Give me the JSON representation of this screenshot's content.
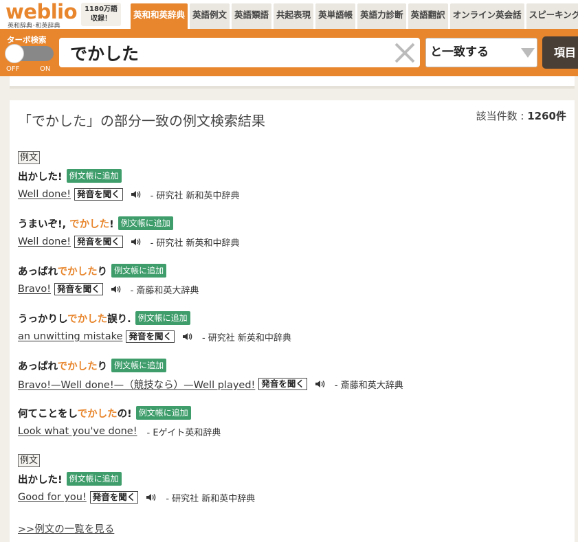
{
  "header": {
    "logo_text": "weblio",
    "logo_sub": "英和辞典･和英辞典",
    "count_line1": "1180万語",
    "count_line2": "収録！",
    "nav_tabs": [
      "英和和英辞典",
      "英語例文",
      "英語類語",
      "共起表現",
      "英単語帳",
      "英語力診断",
      "英語翻訳",
      "オンライン英会話",
      "スピーキング"
    ]
  },
  "search": {
    "turbo_label": "ターボ検索",
    "toggle_off": "OFF",
    "toggle_on": "ON",
    "query": "でかした",
    "match_mode": "と一致する",
    "item_button": "項目"
  },
  "results": {
    "title": "「でかした」の部分一致の例文検索結果",
    "count_label": "該当件数 : ",
    "count_value": "1260件",
    "section_label": "例文",
    "add_label": "例文帳に追加",
    "listen_label": "発音を聞く",
    "more_link": ">>例文の一覧を見る"
  },
  "entries": [
    {
      "ja_pre": "出かした!",
      "ja_hl": "",
      "ja_post": "",
      "en": [
        "Well done!"
      ],
      "source": "- 研究社 新和英中辞典"
    },
    {
      "ja_pre": "うまいぞ!, ",
      "ja_hl": "でかした",
      "ja_post": "!",
      "en": [
        "Well done!"
      ],
      "source": "- 研究社 新英和中辞典"
    },
    {
      "ja_pre": "あっぱれ",
      "ja_hl": "でかした",
      "ja_post": "り",
      "en": [
        "Bravo!"
      ],
      "source": "- 斎藤和英大辞典"
    },
    {
      "ja_pre": "うっかりし",
      "ja_hl": "でかした",
      "ja_post": "誤り.",
      "en": [
        "an unwitting mistake"
      ],
      "source": "- 研究社 新英和中辞典"
    },
    {
      "ja_pre": "あっぱれ",
      "ja_hl": "でかした",
      "ja_post": "り",
      "en": [
        "Bravo!—Well done!—（競技なら）—Well played!"
      ],
      "source": "- 斎藤和英大辞典"
    },
    {
      "ja_pre": "何てことをし",
      "ja_hl": "でかした",
      "ja_post": "の!",
      "en": [
        "Look what you've done!"
      ],
      "source": "- Eゲイト英和辞典"
    },
    {
      "ja_pre": "出かした!",
      "ja_hl": "",
      "ja_post": "",
      "en": [
        "Good for you!"
      ],
      "source": "- 研究社 新和英中辞典"
    }
  ]
}
